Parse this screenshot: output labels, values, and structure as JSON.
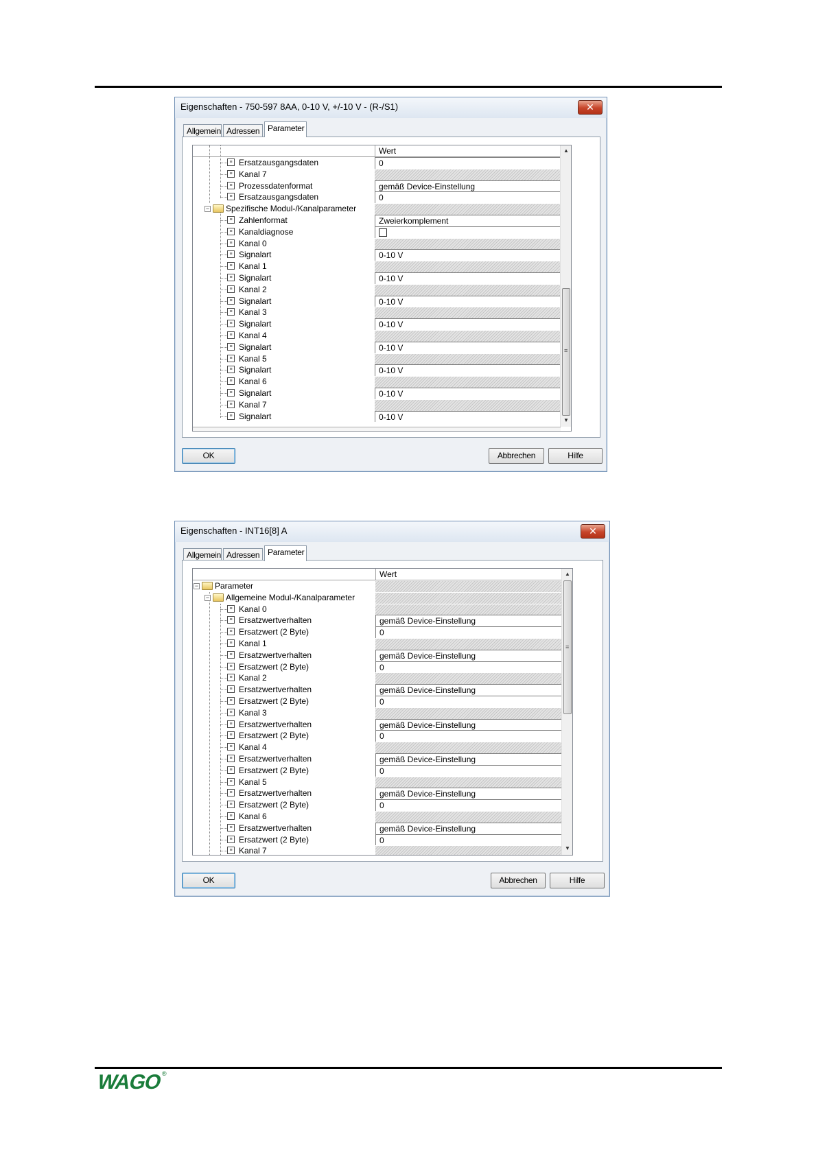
{
  "dialog1": {
    "title": "Eigenschaften - 750-597 8AA, 0-10 V, +/-10 V - (R-/S1)",
    "close_label": "✕",
    "tabs": [
      "Allgemein",
      "Adressen",
      "Parameter"
    ],
    "active_tab": "Parameter",
    "column_header": "Wert",
    "rows": [
      {
        "label": "Ersatzausgangsdaten",
        "value": "0",
        "kind": "edit",
        "level": 3
      },
      {
        "label": "Kanal 7",
        "value": "",
        "kind": "hatch",
        "level": 3
      },
      {
        "label": "Prozessdatenformat",
        "value": "gemäß Device-Einstellung",
        "kind": "edit",
        "level": 3
      },
      {
        "label": "Ersatzausgangsdaten",
        "value": "0",
        "kind": "edit",
        "level": 3
      },
      {
        "label": "Spezifische Modul-/Kanalparameter",
        "value": "",
        "kind": "hatch",
        "level": 2,
        "folder": true
      },
      {
        "label": "Zahlenformat",
        "value": "Zweierkomplement",
        "kind": "edit",
        "level": 3
      },
      {
        "label": "Kanaldiagnose",
        "value": "",
        "kind": "checkbox",
        "level": 3
      },
      {
        "label": "Kanal 0",
        "value": "",
        "kind": "hatch",
        "level": 3
      },
      {
        "label": "Signalart",
        "value": "0-10 V",
        "kind": "edit",
        "level": 3
      },
      {
        "label": "Kanal 1",
        "value": "",
        "kind": "hatch",
        "level": 3
      },
      {
        "label": "Signalart",
        "value": "0-10 V",
        "kind": "edit",
        "level": 3
      },
      {
        "label": "Kanal 2",
        "value": "",
        "kind": "hatch",
        "level": 3
      },
      {
        "label": "Signalart",
        "value": "0-10 V",
        "kind": "edit",
        "level": 3
      },
      {
        "label": "Kanal 3",
        "value": "",
        "kind": "hatch",
        "level": 3
      },
      {
        "label": "Signalart",
        "value": "0-10 V",
        "kind": "edit",
        "level": 3
      },
      {
        "label": "Kanal 4",
        "value": "",
        "kind": "hatch",
        "level": 3
      },
      {
        "label": "Signalart",
        "value": "0-10 V",
        "kind": "edit",
        "level": 3
      },
      {
        "label": "Kanal 5",
        "value": "",
        "kind": "hatch",
        "level": 3
      },
      {
        "label": "Signalart",
        "value": "0-10 V",
        "kind": "edit",
        "level": 3
      },
      {
        "label": "Kanal 6",
        "value": "",
        "kind": "hatch",
        "level": 3
      },
      {
        "label": "Signalart",
        "value": "0-10 V",
        "kind": "edit",
        "level": 3
      },
      {
        "label": "Kanal 7",
        "value": "",
        "kind": "hatch",
        "level": 3
      },
      {
        "label": "Signalart",
        "value": "0-10 V",
        "kind": "edit",
        "level": 3
      }
    ],
    "buttons": {
      "ok": "OK",
      "cancel": "Abbrechen",
      "help": "Hilfe"
    }
  },
  "dialog2": {
    "title": "Eigenschaften - INT16[8] A",
    "close_label": "✕",
    "tabs": [
      "Allgemein",
      "Adressen",
      "Parameter"
    ],
    "active_tab": "Parameter",
    "column_header": "Wert",
    "rows": [
      {
        "label": "Parameter",
        "value": "",
        "kind": "hatch",
        "level": 1,
        "folder": true
      },
      {
        "label": "Allgemeine Modul-/Kanalparameter",
        "value": "",
        "kind": "hatch",
        "level": 2,
        "folder": true
      },
      {
        "label": "Kanal 0",
        "value": "",
        "kind": "hatch",
        "level": 3
      },
      {
        "label": "Ersatzwertverhalten",
        "value": "gemäß Device-Einstellung",
        "kind": "edit",
        "level": 3
      },
      {
        "label": "Ersatzwert (2 Byte)",
        "value": "0",
        "kind": "edit",
        "level": 3
      },
      {
        "label": "Kanal 1",
        "value": "",
        "kind": "hatch",
        "level": 3
      },
      {
        "label": "Ersatzwertverhalten",
        "value": "gemäß Device-Einstellung",
        "kind": "edit",
        "level": 3
      },
      {
        "label": "Ersatzwert (2 Byte)",
        "value": "0",
        "kind": "edit",
        "level": 3
      },
      {
        "label": "Kanal 2",
        "value": "",
        "kind": "hatch",
        "level": 3
      },
      {
        "label": "Ersatzwertverhalten",
        "value": "gemäß Device-Einstellung",
        "kind": "edit",
        "level": 3
      },
      {
        "label": "Ersatzwert (2 Byte)",
        "value": "0",
        "kind": "edit",
        "level": 3
      },
      {
        "label": "Kanal 3",
        "value": "",
        "kind": "hatch",
        "level": 3
      },
      {
        "label": "Ersatzwertverhalten",
        "value": "gemäß Device-Einstellung",
        "kind": "edit",
        "level": 3
      },
      {
        "label": "Ersatzwert (2 Byte)",
        "value": "0",
        "kind": "edit",
        "level": 3
      },
      {
        "label": "Kanal 4",
        "value": "",
        "kind": "hatch",
        "level": 3
      },
      {
        "label": "Ersatzwertverhalten",
        "value": "gemäß Device-Einstellung",
        "kind": "edit",
        "level": 3
      },
      {
        "label": "Ersatzwert (2 Byte)",
        "value": "0",
        "kind": "edit",
        "level": 3
      },
      {
        "label": "Kanal 5",
        "value": "",
        "kind": "hatch",
        "level": 3
      },
      {
        "label": "Ersatzwertverhalten",
        "value": "gemäß Device-Einstellung",
        "kind": "edit",
        "level": 3
      },
      {
        "label": "Ersatzwert (2 Byte)",
        "value": "0",
        "kind": "edit",
        "level": 3
      },
      {
        "label": "Kanal 6",
        "value": "",
        "kind": "hatch",
        "level": 3
      },
      {
        "label": "Ersatzwertverhalten",
        "value": "gemäß Device-Einstellung",
        "kind": "edit",
        "level": 3
      },
      {
        "label": "Ersatzwert (2 Byte)",
        "value": "0",
        "kind": "edit",
        "level": 3
      },
      {
        "label": "Kanal 7",
        "value": "",
        "kind": "hatch",
        "level": 3
      }
    ],
    "buttons": {
      "ok": "OK",
      "cancel": "Abbrechen",
      "help": "Hilfe"
    }
  },
  "footer": {
    "logo_text": "WAGO",
    "registered_mark": "®"
  },
  "icons": {
    "item": "parameter-item-icon",
    "folder": "folder-icon",
    "collapse": "collapse-minus-icon"
  },
  "colors": {
    "title_bar": "#dde6f1",
    "close_button": "#c7452a",
    "logo": "#1a7c3a"
  }
}
